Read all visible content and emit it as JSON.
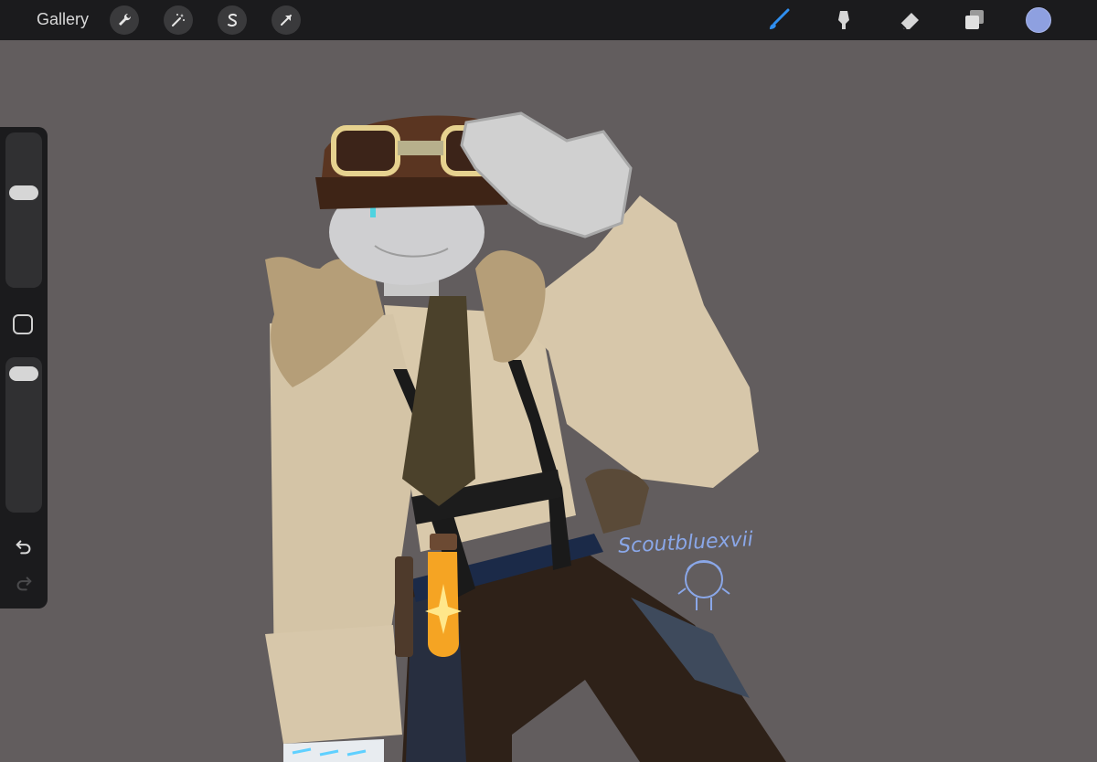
{
  "toolbar": {
    "gallery_label": "Gallery",
    "left_tools": [
      "wrench-icon",
      "magic-wand-icon",
      "selection-s-icon",
      "transform-arrow-icon"
    ],
    "right_tools": [
      "brush-icon",
      "smudge-icon",
      "eraser-icon",
      "layers-icon"
    ],
    "current_color": "#8ea0e0"
  },
  "sidebar": {
    "brush_size_level": 0.37,
    "opacity_level": 0.04
  },
  "canvas": {
    "background": "#625d5e",
    "signature_text": "Scoutbluexvii"
  }
}
